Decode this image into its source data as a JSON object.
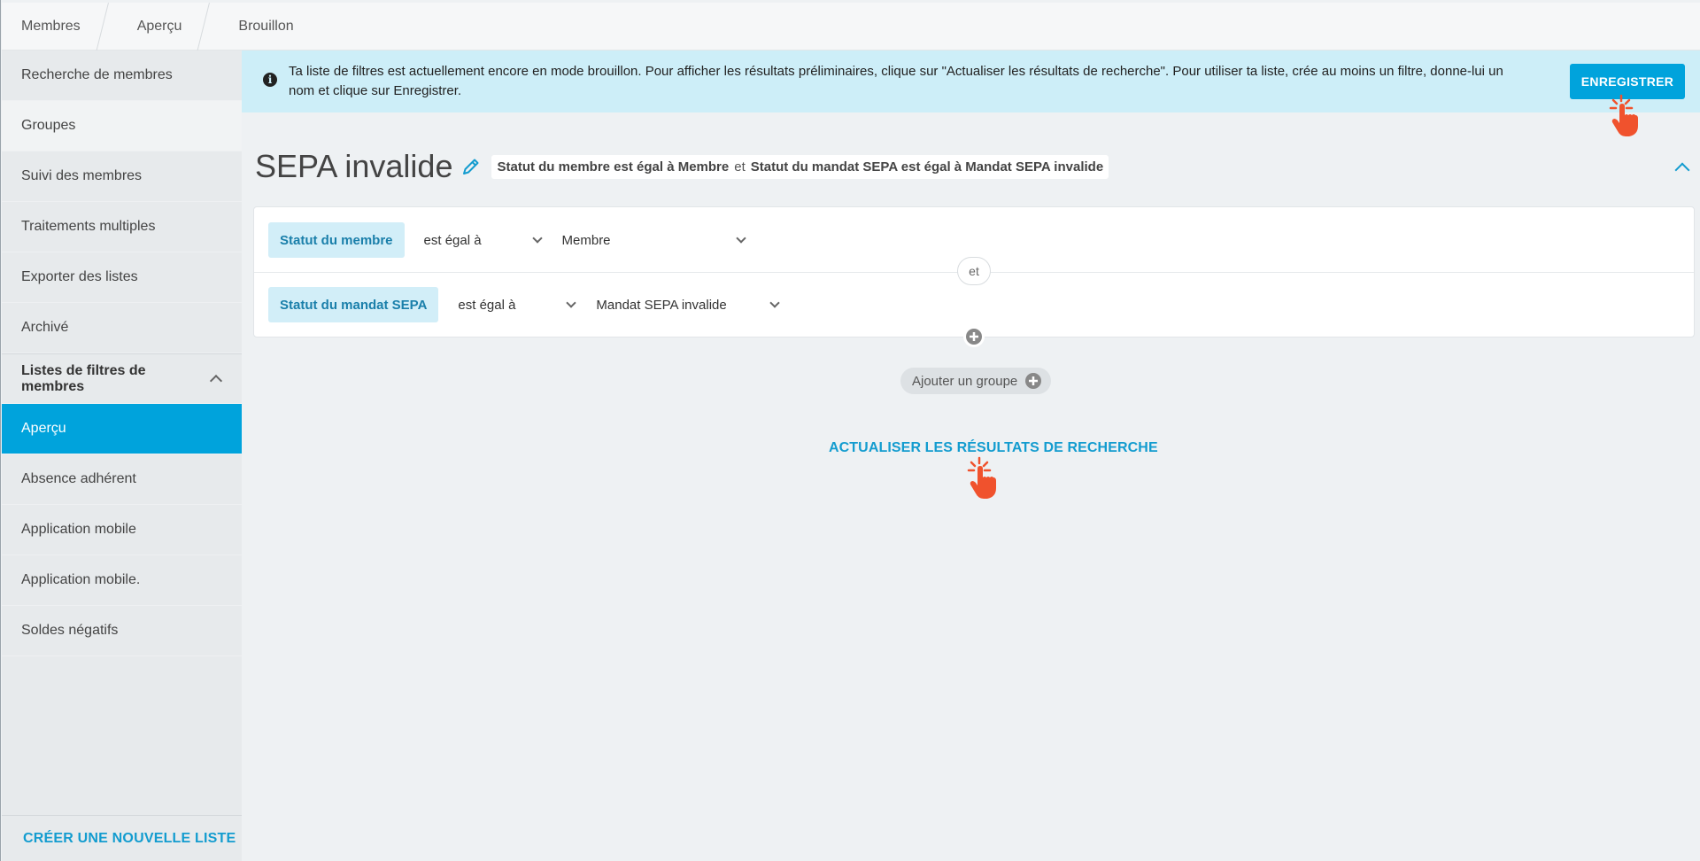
{
  "breadcrumb": [
    "Membres",
    "Aperçu",
    "Brouillon"
  ],
  "sidebar": {
    "items": [
      {
        "label": "Recherche de membres"
      },
      {
        "label": "Groupes"
      },
      {
        "label": "Suivi des membres"
      },
      {
        "label": "Traitements multiples"
      },
      {
        "label": "Exporter des listes"
      },
      {
        "label": "Archivé"
      }
    ],
    "section_label": "Listes de filtres de membres",
    "sub_items": [
      {
        "label": "Aperçu",
        "active": true
      },
      {
        "label": "Absence adhérent"
      },
      {
        "label": "Application mobile"
      },
      {
        "label": "Application mobile."
      },
      {
        "label": "Soldes négatifs"
      }
    ],
    "footer_label": "CRÉER UNE NOUVELLE LISTE"
  },
  "banner": {
    "text": "Ta liste de filtres est actuellement encore en mode brouillon. Pour afficher les résultats préliminaires, clique sur \"Actualiser les résultats de recherche\". Pour utiliser ta liste, crée au moins un filtre, donne-lui un nom et clique sur Enregistrer.",
    "save_label": "ENREGISTRER"
  },
  "list": {
    "title": "SEPA invalide",
    "summary": {
      "part1": "Statut du membre est égal à Membre",
      "joiner": "et",
      "part2": "Statut du mandat SEPA est égal à Mandat SEPA invalide"
    }
  },
  "filters": [
    {
      "field": "Statut du membre",
      "operator": "est égal à",
      "value": "Membre"
    },
    {
      "field": "Statut du mandat SEPA",
      "operator": "est égal à",
      "value": "Mandat SEPA invalide"
    }
  ],
  "joiner_badge": "et",
  "add_group_label": "Ajouter un groupe",
  "refresh_label": "ACTUALISER LES RÉSULTATS DE RECHERCHE",
  "colors": {
    "accent": "#00a3dc",
    "link": "#139ccf",
    "banner_bg": "#cdeef8",
    "cursor_hint": "#f0522d"
  }
}
